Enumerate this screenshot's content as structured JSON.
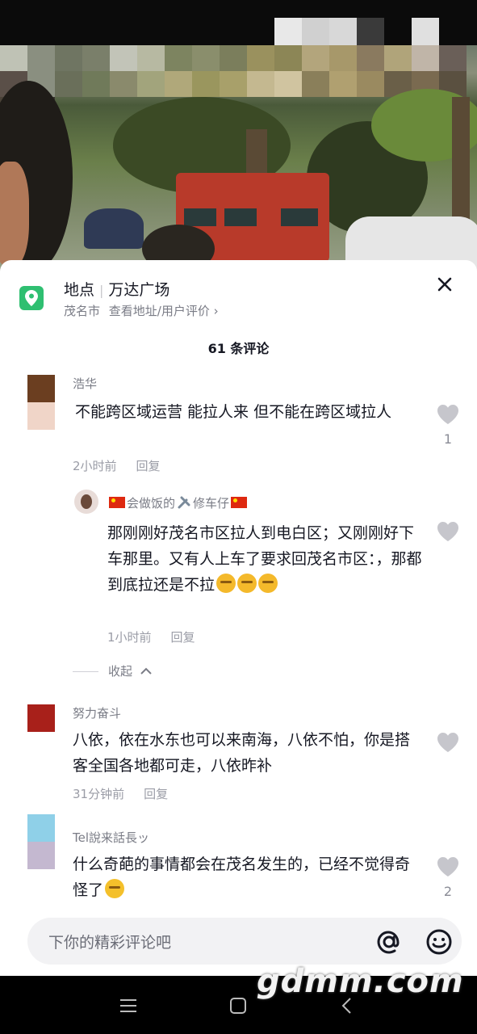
{
  "location": {
    "title_prefix": "地点",
    "title_name": "万达广场",
    "city": "茂名市",
    "link_text": "查看地址/用户评价 ›"
  },
  "comments_header": "61 条评论",
  "comments": [
    {
      "user": "浩华",
      "text": "不能跨区域运营 能拉人来 但不能在跨区域拉人",
      "time": "2小时前",
      "reply": "回复",
      "likes": "1",
      "avatar_colors": [
        "#6b3e20",
        "#f0d5c8"
      ]
    },
    {
      "user_mid": "会做饭的",
      "user_end": "修车仔",
      "text": "那刚刚好茂名市区拉人到电白区；又刚刚好下车那里。又有人上车了要求回茂名市区：，那都到底拉还是不拉",
      "time": "1小时前",
      "reply": "回复"
    },
    {
      "user": "努力奋斗",
      "text": "八依，依在水东也可以来南海，八依不怕，你是搭客全国各地都可走，八依昨补",
      "time": "31分钟前",
      "reply": "回复",
      "avatar_colors": [
        "#a8201a",
        "#ffffff"
      ]
    },
    {
      "user": "Tel說来話長ッ",
      "text": "什么奇葩的事情都会在茂名发生的，已经不觉得奇怪了",
      "likes": "2",
      "avatar_colors": [
        "#8fd0e8",
        "#c4b8d0"
      ]
    }
  ],
  "collapse_label": "收起",
  "input_placeholder": "下你的精彩评论吧",
  "watermark": "gdmm.com",
  "icons": [
    "location-pin-icon",
    "close-icon",
    "heart-icon",
    "at-icon",
    "emoji-icon",
    "menu-icon",
    "home-icon",
    "back-icon"
  ]
}
